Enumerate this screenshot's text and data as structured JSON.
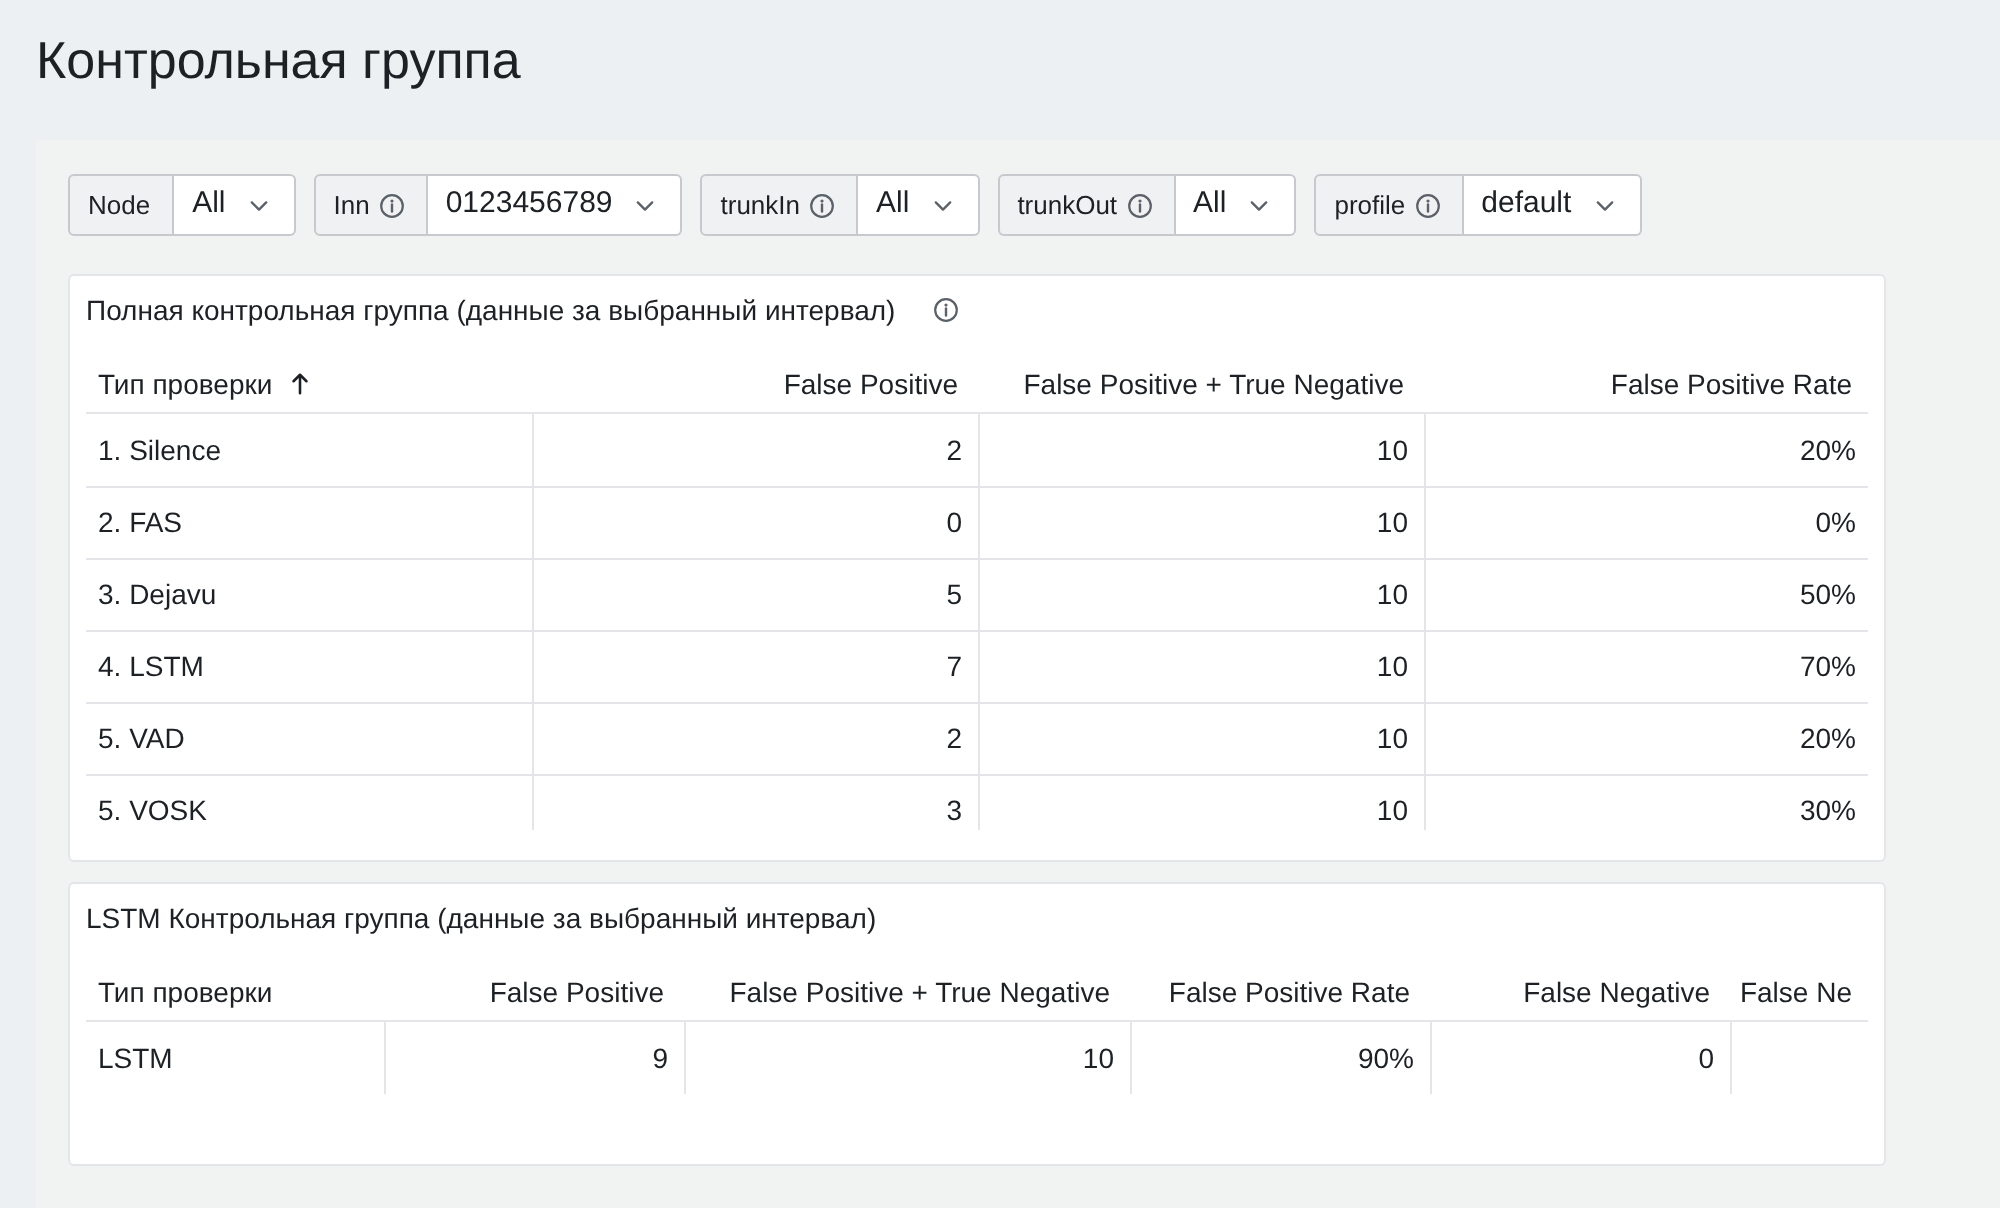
{
  "page": {
    "title": "Контрольная группа"
  },
  "filters": [
    {
      "label": "Node",
      "info": false,
      "value": "All"
    },
    {
      "label": "Inn",
      "info": true,
      "value": "0123456789"
    },
    {
      "label": "trunkIn",
      "info": true,
      "value": "All"
    },
    {
      "label": "trunkOut",
      "info": true,
      "value": "All"
    },
    {
      "label": "profile",
      "info": true,
      "value": "default"
    }
  ],
  "cards": [
    {
      "title": "Полная контрольная группа (данные за выбранный интервал)",
      "info": true,
      "table": {
        "columns": [
          {
            "label": "Тип проверки",
            "sorted": true
          },
          {
            "label": "False Positive",
            "sorted": false
          },
          {
            "label": "False Positive + True Negative",
            "sorted": false
          },
          {
            "label": "False Positive Rate",
            "sorted": false
          }
        ],
        "rows": [
          [
            "1. Silence",
            "2",
            "10",
            "20%"
          ],
          [
            "2. FAS",
            "0",
            "10",
            "0%"
          ],
          [
            "3. Dejavu",
            "5",
            "10",
            "50%"
          ],
          [
            "4. LSTM",
            "7",
            "10",
            "70%"
          ],
          [
            "5. VAD",
            "2",
            "10",
            "20%"
          ],
          [
            "5. VOSK",
            "3",
            "10",
            "30%"
          ]
        ]
      }
    },
    {
      "title": "LSTM Контрольная группа (данные за выбранный интервал)",
      "info": false,
      "table": {
        "columns": [
          {
            "label": "Тип проверки",
            "sorted": false
          },
          {
            "label": "False Positive",
            "sorted": false
          },
          {
            "label": "False Positive + True Negative",
            "sorted": false
          },
          {
            "label": "False Positive Rate",
            "sorted": false
          },
          {
            "label": "False Negative",
            "sorted": false
          },
          {
            "label": "False Ne",
            "sorted": false
          }
        ],
        "rows": [
          [
            "LSTM",
            "9",
            "10",
            "90%",
            "0"
          ]
        ]
      }
    }
  ]
}
